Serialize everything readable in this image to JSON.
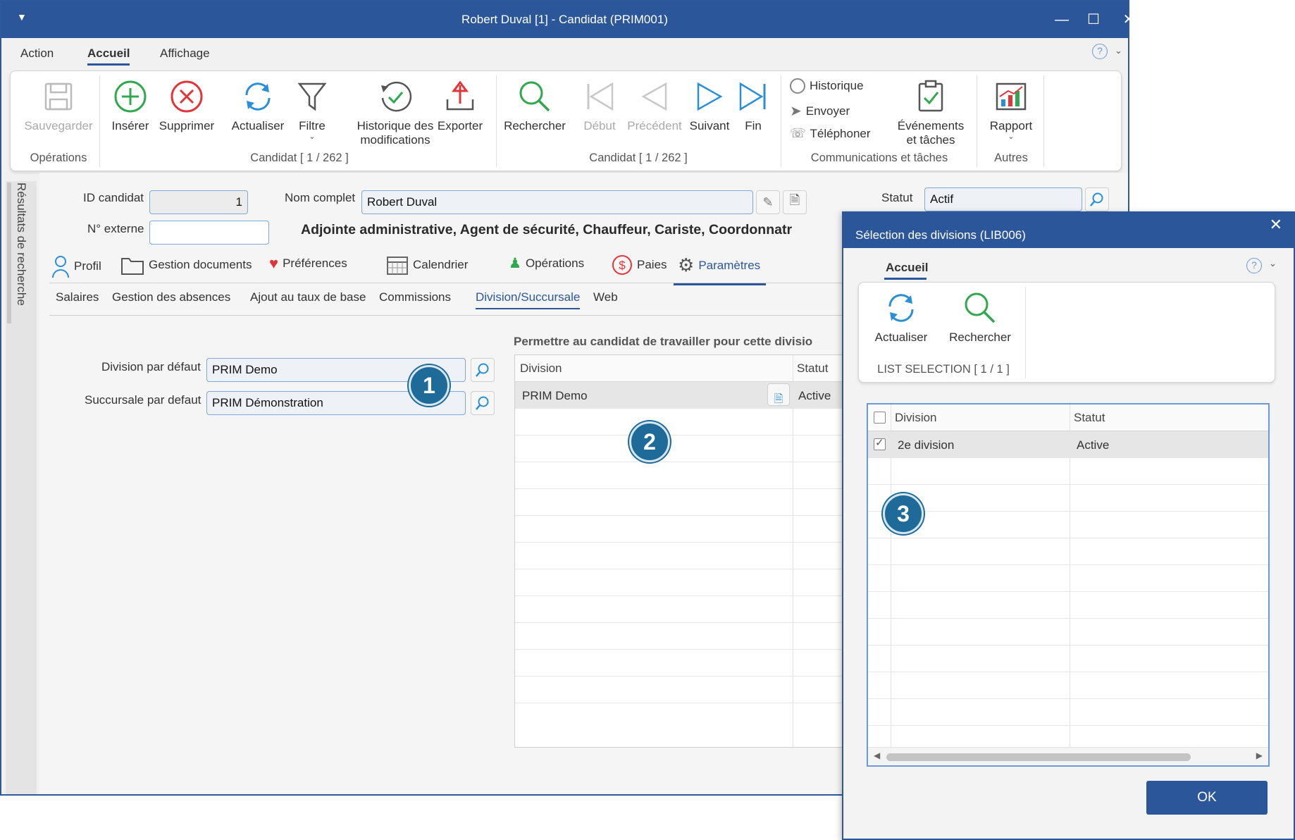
{
  "window": {
    "title": "Robert Duval [1] - Candidat (PRIM001)",
    "menu": [
      "Action",
      "Accueil",
      "Affichage"
    ],
    "active_menu": "Accueil",
    "help": "?"
  },
  "ribbon": {
    "save": "Sauvegarder",
    "insert": "Insérer",
    "delete": "Supprimer",
    "refresh": "Actualiser",
    "filter": "Filtre",
    "history_line1": "Historique des",
    "history_line2": "modifications",
    "export": "Exporter",
    "search": "Rechercher",
    "start": "Début",
    "previous": "Précédent",
    "next": "Suivant",
    "end": "Fin",
    "historique": "Historique",
    "envoyer": "Envoyer",
    "telephoner": "Téléphoner",
    "events_line1": "Événements",
    "events_line2": "et tâches",
    "report": "Rapport",
    "group_operations": "Opérations",
    "group_candidat_1": "Candidat [ 1 / 262 ]",
    "group_candidat_2": "Candidat [ 1 / 262 ]",
    "group_comms": "Communications et tâches",
    "group_autres": "Autres"
  },
  "sidebar": {
    "label": "Résultats de recherche"
  },
  "form": {
    "id_label": "ID candidat",
    "id_value": "1",
    "fullname_label": "Nom complet",
    "fullname_value": "Robert Duval",
    "status_label": "Statut",
    "status_value": "Actif",
    "external_label": "N° externe",
    "external_value": "",
    "headline": "Adjointe administrative, Agent de sécurité, Chauffeur, Cariste, Coordonnatr"
  },
  "tabs": {
    "profil": "Profil",
    "documents": "Gestion documents",
    "preferences": "Préférences",
    "calendrier": "Calendrier",
    "operations": "Opérations",
    "paies": "Paies",
    "parametres": "Paramètres"
  },
  "subtabs": {
    "salaires": "Salaires",
    "absences": "Gestion des absences",
    "ajout": "Ajout au taux de base",
    "commissions": "Commissions",
    "division": "Division/Succursale",
    "web": "Web"
  },
  "division": {
    "default_division_label": "Division par défaut",
    "default_division_value": "PRIM Demo",
    "default_branch_label": "Succursale par defaut",
    "default_branch_value": "PRIM Démonstration",
    "allow_title": "Permettre au candidat de travailler pour cette divisio",
    "col_division": "Division",
    "col_statut": "Statut",
    "row_division": "PRIM Demo",
    "row_statut": "Active"
  },
  "badges": [
    "1",
    "2",
    "3"
  ],
  "dialog": {
    "title": "Sélection des divisions (LIB006)",
    "close": "✕",
    "menu": "Accueil",
    "help": "?",
    "refresh": "Actualiser",
    "search": "Rechercher",
    "group": "LIST SELECTION [ 1 / 1 ]",
    "col_division": "Division",
    "col_statut": "Statut",
    "row_division": "2e division",
    "row_statut": "Active",
    "ok": "OK"
  },
  "colors": {
    "accent": "#2b579a",
    "badge": "#1e6a99",
    "green": "#2fa84f",
    "red": "#e0363a",
    "blue_icon": "#2a8fd6"
  }
}
